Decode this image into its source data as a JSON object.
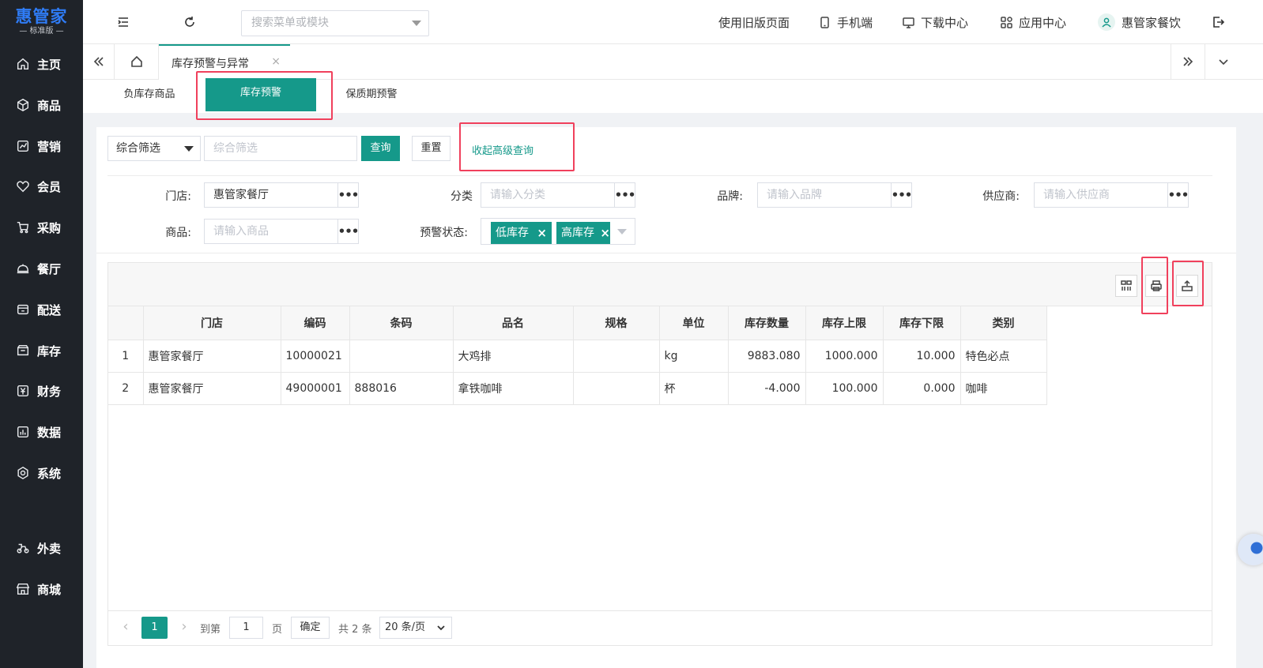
{
  "logo": {
    "main": "惠管家",
    "sub": "— 标准版 —"
  },
  "sidebar": {
    "items": [
      {
        "label": "主页",
        "icon": "home-icon"
      },
      {
        "label": "商品",
        "icon": "cube-icon"
      },
      {
        "label": "营销",
        "icon": "chart-icon"
      },
      {
        "label": "会员",
        "icon": "heart-icon"
      },
      {
        "label": "采购",
        "icon": "cart-icon"
      },
      {
        "label": "餐厅",
        "icon": "cloche-icon"
      },
      {
        "label": "配送",
        "icon": "delivery-icon"
      },
      {
        "label": "库存",
        "icon": "box-icon"
      },
      {
        "label": "财务",
        "icon": "yuan-icon"
      },
      {
        "label": "数据",
        "icon": "bar-chart-icon"
      },
      {
        "label": "系统",
        "icon": "gear-icon"
      },
      {
        "label": "外卖",
        "icon": "scooter-icon"
      },
      {
        "label": "商城",
        "icon": "store-icon"
      }
    ]
  },
  "header": {
    "search_placeholder": "搜索菜单或模块",
    "links": {
      "old_page": "使用旧版页面",
      "mobile": "手机端",
      "download": "下载中心",
      "apps": "应用中心",
      "user": "惠管家餐饮"
    }
  },
  "tabs": {
    "current": "库存预警与异常",
    "close": "×"
  },
  "subtabs": [
    "负库存商品",
    "库存预警",
    "保质期预警"
  ],
  "filters": {
    "combo_select": "综合筛选",
    "combo_placeholder": "综合筛选",
    "query": "查询",
    "reset": "重置",
    "collapse": "收起高级查询",
    "store_label": "门店:",
    "store_value": "惠管家餐厅",
    "category_label": "分类",
    "category_placeholder": "请输入分类",
    "brand_label": "品牌:",
    "brand_placeholder": "请输入品牌",
    "supplier_label": "供应商:",
    "supplier_placeholder": "请输入供应商",
    "product_label": "商品:",
    "product_placeholder": "请输入商品",
    "status_label": "预警状态:",
    "status_tags": [
      "低库存",
      "高库存"
    ],
    "more": "•••"
  },
  "table": {
    "columns": [
      "门店",
      "编码",
      "条码",
      "品名",
      "规格",
      "单位",
      "库存数量",
      "库存上限",
      "库存下限",
      "类别"
    ],
    "rows": [
      {
        "idx": "1",
        "store": "惠管家餐厅",
        "code": "10000021",
        "barcode": "",
        "name": "大鸡排",
        "spec": "",
        "unit": "kg",
        "qty": "9883.080",
        "upper": "1000.000",
        "lower": "10.000",
        "category": "特色必点"
      },
      {
        "idx": "2",
        "store": "惠管家餐厅",
        "code": "49000001",
        "barcode": "888016",
        "name": "拿铁咖啡",
        "spec": "",
        "unit": "杯",
        "qty": "-4.000",
        "upper": "100.000",
        "lower": "0.000",
        "category": "咖啡"
      }
    ]
  },
  "pager": {
    "current": "1",
    "goto_label": "到第",
    "goto_value": "1",
    "page_unit": "页",
    "confirm": "确定",
    "total": "共 2 条",
    "page_size": "20 条/页"
  },
  "colors": {
    "accent": "#15998a",
    "sidebar": "#1f2329",
    "highlight": "#f0405c"
  }
}
